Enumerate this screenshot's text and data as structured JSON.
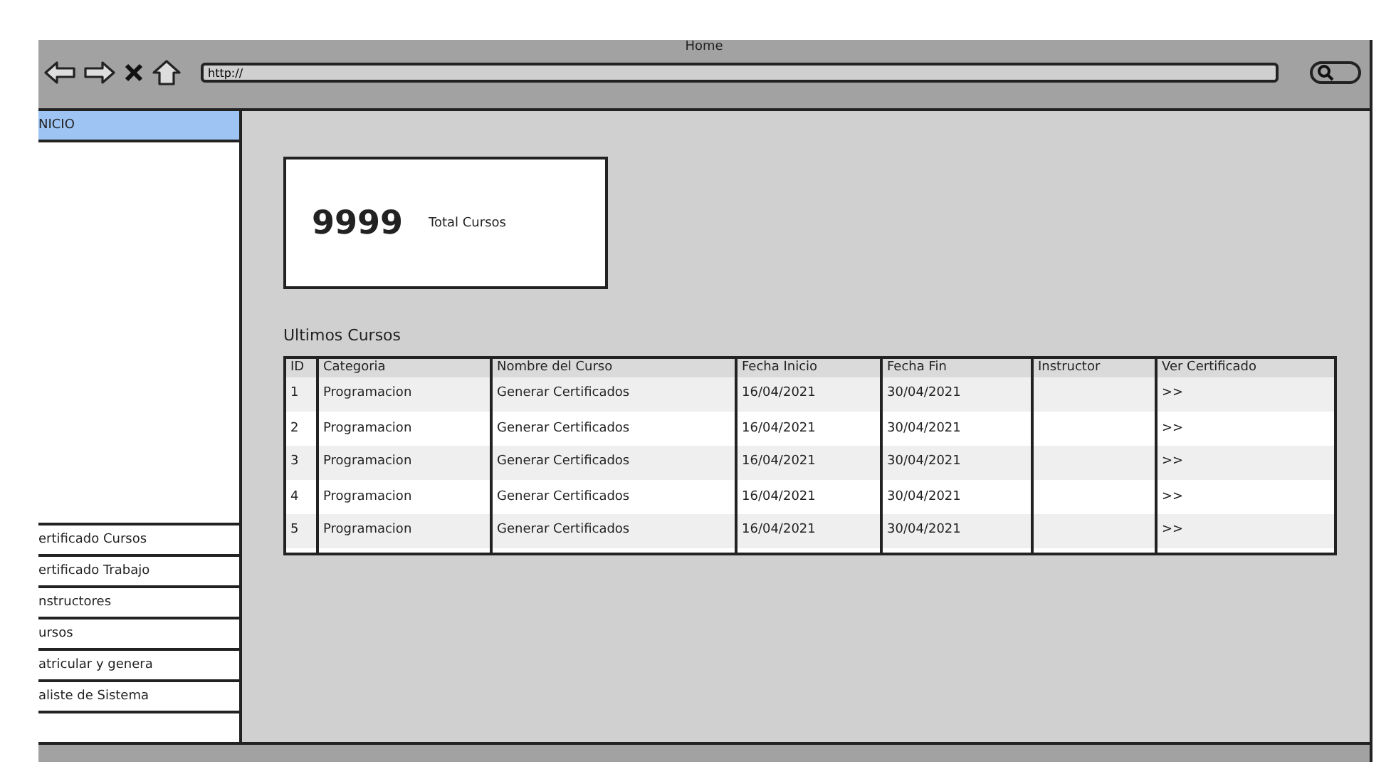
{
  "window": {
    "title": "Home"
  },
  "address_bar": {
    "value": "http://"
  },
  "sidebar": {
    "top_items": [
      {
        "label": "NICIO",
        "selected": true
      }
    ],
    "bottom_items": [
      {
        "label": "ertificado Cursos",
        "selected": false
      },
      {
        "label": "ertificado Trabajo",
        "selected": false
      },
      {
        "label": "nstructores",
        "selected": false
      },
      {
        "label": "ursos",
        "selected": false
      },
      {
        "label": "atricular y genera",
        "selected": false
      },
      {
        "label": "aliste de Sistema",
        "selected": false
      }
    ]
  },
  "summary_card": {
    "value": "9999",
    "label": "Total Cursos"
  },
  "table": {
    "title": "Ultimos Cursos",
    "columns": [
      "ID",
      "Categoria",
      "Nombre del Curso",
      "Fecha Inicio",
      "Fecha Fin",
      "Instructor",
      "Ver Certificado"
    ],
    "rows": [
      {
        "id": "1",
        "categoria": "Programacion",
        "nombre": "Generar Certificados",
        "inicio": "16/04/2021",
        "fin": "30/04/2021",
        "ver": ">>"
      },
      {
        "id": "2",
        "categoria": "Programacion",
        "nombre": "Generar Certificados",
        "inicio": "16/04/2021",
        "fin": "30/04/2021",
        "ver": ">>"
      },
      {
        "id": "3",
        "categoria": "Programacion",
        "nombre": "Generar Certificados",
        "inicio": "16/04/2021",
        "fin": "30/04/2021",
        "ver": ">>"
      },
      {
        "id": "4",
        "categoria": "Programacion",
        "nombre": "Generar Certificados",
        "inicio": "16/04/2021",
        "fin": "30/04/2021",
        "ver": ">>"
      },
      {
        "id": "5",
        "categoria": "Programacion",
        "nombre": "Generar Certificados",
        "inicio": "16/04/2021",
        "fin": "30/04/2021",
        "ver": ">>"
      }
    ]
  }
}
